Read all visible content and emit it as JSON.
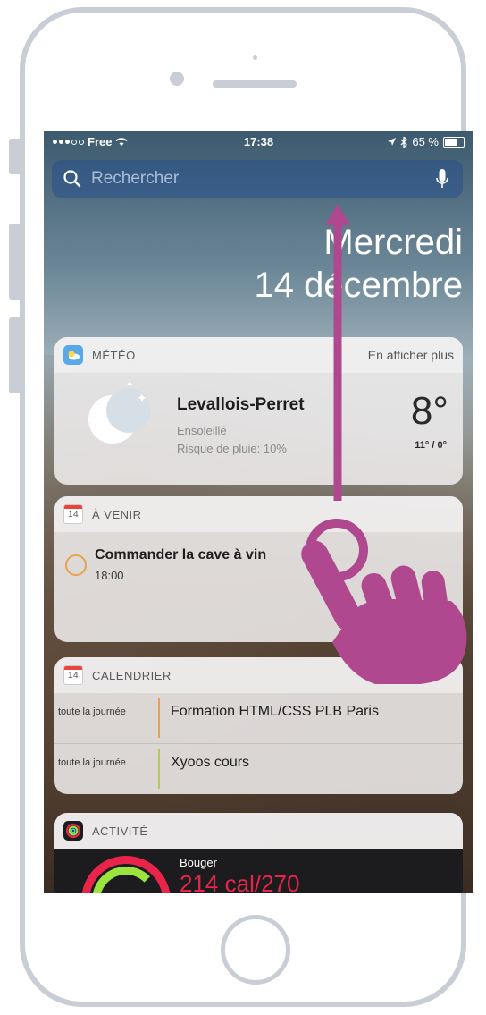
{
  "status_bar": {
    "carrier": "Free",
    "time": "17:38",
    "battery": "65 %"
  },
  "search": {
    "placeholder": "Rechercher"
  },
  "date": {
    "weekday": "Mercredi",
    "day": "14 décembre"
  },
  "weather_widget": {
    "title": "MÉTÉO",
    "more_label": "En afficher plus",
    "city": "Levallois-Perret",
    "condition": "Ensoleillé",
    "rain": "Risque de pluie: 10%",
    "temperature": "8°",
    "min_max": "11° / 0°"
  },
  "upcoming_widget": {
    "title": "À VENIR",
    "icon_day": "14",
    "event_title": "Commander la cave à vin",
    "event_time": "18:00"
  },
  "calendar_widget": {
    "title": "CALENDRIER",
    "icon_day": "14",
    "events": [
      {
        "when": "toute la journée",
        "title": "Formation HTML/CSS PLB Paris",
        "color": "#e8a24e"
      },
      {
        "when": "toute la journée",
        "title": "Xyoos cours",
        "color": "#b3c95a"
      }
    ]
  },
  "activity_widget": {
    "title": "ACTIVITÉ",
    "label": "Bouger",
    "value": "214 cal/270"
  },
  "colors": {
    "gesture": "#b0488f",
    "accent_red": "#e8244b"
  },
  "icons": [
    "magnifier-icon",
    "microphone-icon",
    "weather-icon",
    "calendar-icon",
    "activity-icon",
    "moon-icon",
    "swipe-hand-icon"
  ]
}
